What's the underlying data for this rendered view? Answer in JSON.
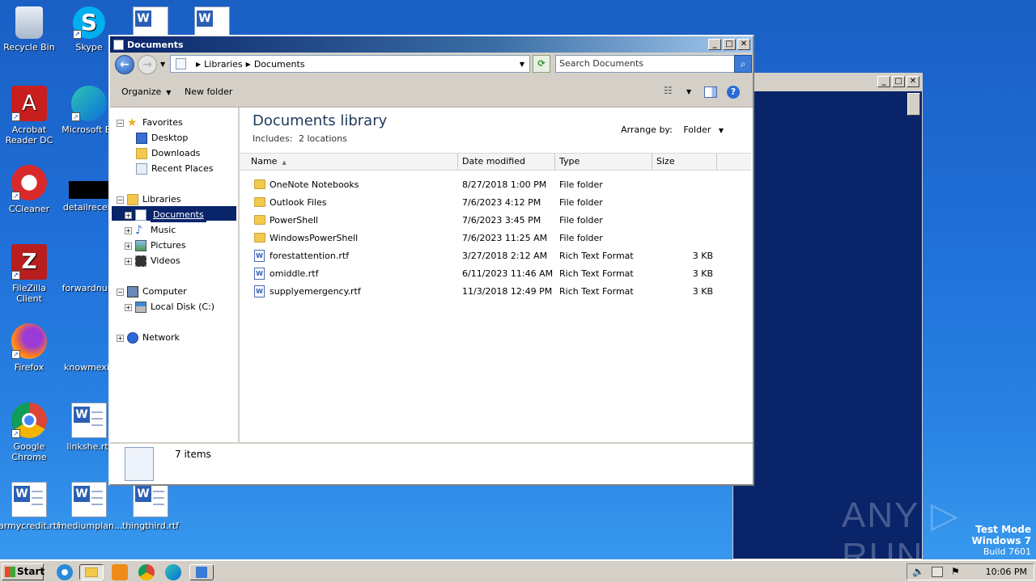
{
  "desktop": {
    "icons": [
      {
        "label": "Recycle Bin"
      },
      {
        "label": "Skype"
      },
      {
        "label": "Acrobat Reader DC"
      },
      {
        "label": "Microsoft Ed"
      },
      {
        "label": "CCleaner"
      },
      {
        "label": "detailreceiv"
      },
      {
        "label": "FileZilla Client"
      },
      {
        "label": "forwardnum"
      },
      {
        "label": "Firefox"
      },
      {
        "label": "knowmexic"
      },
      {
        "label": "Google Chrome"
      },
      {
        "label": "linkshe.rtf"
      },
      {
        "label": "armycredit.rtf"
      },
      {
        "label": "mediumplan..."
      },
      {
        "label": "thingthird.rtf"
      }
    ]
  },
  "window": {
    "title": "Documents",
    "buttons": {
      "minimize": "_",
      "maximize": "□",
      "close": "✕"
    }
  },
  "address": {
    "path": [
      "Libraries",
      "Documents"
    ],
    "search_placeholder": "Search Documents"
  },
  "toolbar": {
    "organize_label": "Organize",
    "new_folder_label": "New folder"
  },
  "nav": {
    "favorites": "Favorites",
    "desktop": "Desktop",
    "downloads": "Downloads",
    "recent_places": "Recent Places",
    "libraries": "Libraries",
    "documents": "Documents",
    "music": "Music",
    "pictures": "Pictures",
    "videos": "Videos",
    "computer": "Computer",
    "local_disk": "Local Disk (C:)",
    "network": "Network"
  },
  "content": {
    "title": "Documents library",
    "includes_label": "Includes:",
    "includes_value": "2 locations",
    "arrange_label": "Arrange by:",
    "arrange_value": "Folder",
    "columns": {
      "name": "Name",
      "date": "Date modified",
      "type": "Type",
      "size": "Size"
    },
    "files": [
      {
        "name": "OneNote Notebooks",
        "date": "8/27/2018 1:00 PM",
        "type": "File folder",
        "size": "",
        "kind": "folder"
      },
      {
        "name": "Outlook Files",
        "date": "7/6/2023 4:12 PM",
        "type": "File folder",
        "size": "",
        "kind": "folder"
      },
      {
        "name": "PowerShell",
        "date": "7/6/2023 3:45 PM",
        "type": "File folder",
        "size": "",
        "kind": "folder"
      },
      {
        "name": "WindowsPowerShell",
        "date": "7/6/2023 11:25 AM",
        "type": "File folder",
        "size": "",
        "kind": "folder"
      },
      {
        "name": "forestattention.rtf",
        "date": "3/27/2018 2:12 AM",
        "type": "Rich Text Format",
        "size": "3 KB",
        "kind": "rtf"
      },
      {
        "name": "omiddle.rtf",
        "date": "6/11/2023 11:46 AM",
        "type": "Rich Text Format",
        "size": "3 KB",
        "kind": "rtf"
      },
      {
        "name": "supplyemergency.rtf",
        "date": "11/3/2018 12:49 PM",
        "type": "Rich Text Format",
        "size": "3 KB",
        "kind": "rtf"
      }
    ]
  },
  "details": {
    "count": "7 items"
  },
  "taskbar": {
    "start_label": "Start",
    "clock": "10:06 PM"
  },
  "watermark": {
    "text": "ANY ▷ RUN"
  },
  "testmode": {
    "line1": "Test Mode",
    "line2": "Windows 7",
    "line3": "Build 7601"
  }
}
